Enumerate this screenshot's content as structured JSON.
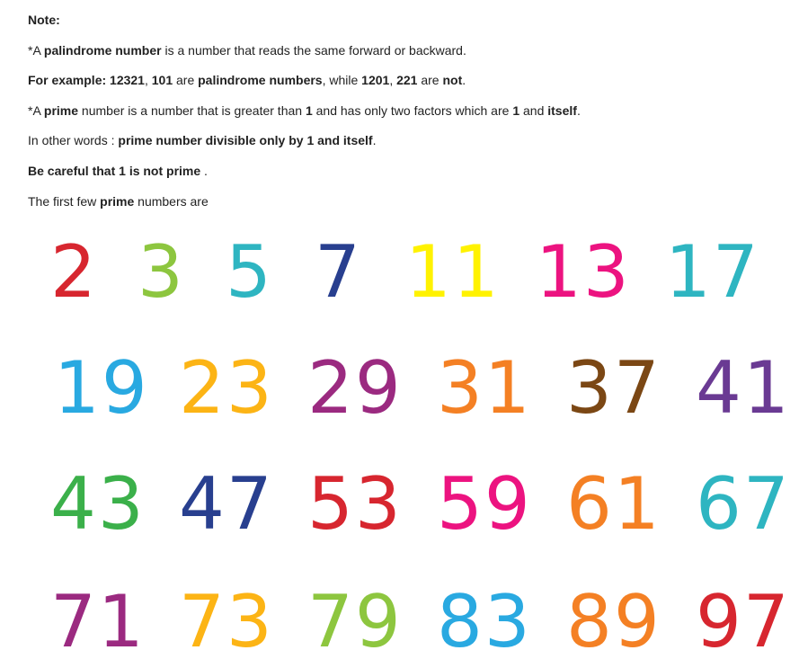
{
  "note": {
    "heading": "Note:",
    "line1": {
      "prefix": "*A ",
      "term": "palindrome number",
      "rest": " is a number that reads the same forward or backward."
    },
    "line2": {
      "label": "For example: ",
      "ex1": "12321",
      "sep1": ", ",
      "ex2": "101",
      "mid1": " are ",
      "term": "palindrome numbers",
      "mid2": ", while ",
      "ex3": "1201",
      "sep2": ", ",
      "ex4": "221",
      "mid3": " are ",
      "neg": "not",
      "end": "."
    },
    "line3": {
      "prefix": "*A ",
      "term": "prime",
      "mid1": " number is a number that is greater than ",
      "one1": "1",
      "mid2": " and has only two factors which are ",
      "one2": "1",
      "mid3": " and ",
      "itself": "itself",
      "end": "."
    },
    "line4": {
      "prefix": "In other words : ",
      "bold": "prime number divisible only by 1 and itself",
      "end": "."
    },
    "line5": {
      "bold": "Be careful that 1 is not prime",
      "end": " ."
    },
    "line6": {
      "prefix": "The first few ",
      "term": "prime",
      "rest": " numbers are"
    }
  },
  "primes": [
    {
      "value": "2",
      "color": "#d7262f"
    },
    {
      "value": "3",
      "color": "#8dc63f"
    },
    {
      "value": "5",
      "color": "#2eb5c1"
    },
    {
      "value": "7",
      "color": "#283f8f"
    },
    {
      "value": "11",
      "color": "#fff200"
    },
    {
      "value": "13",
      "color": "#ec1380"
    },
    {
      "value": "17",
      "color": "#2eb5c1"
    },
    {
      "value": "19",
      "color": "#29a9e1"
    },
    {
      "value": "23",
      "color": "#fcb415"
    },
    {
      "value": "29",
      "color": "#9b2a80"
    },
    {
      "value": "31",
      "color": "#f48024"
    },
    {
      "value": "37",
      "color": "#7b4714"
    },
    {
      "value": "41",
      "color": "#6a3a93"
    },
    {
      "value": "43",
      "color": "#3bb04a"
    },
    {
      "value": "47",
      "color": "#283f8f"
    },
    {
      "value": "53",
      "color": "#d7262f"
    },
    {
      "value": "59",
      "color": "#ec1380"
    },
    {
      "value": "61",
      "color": "#f48024"
    },
    {
      "value": "67",
      "color": "#2eb5c1"
    },
    {
      "value": "71",
      "color": "#9b2a80"
    },
    {
      "value": "73",
      "color": "#fcb415"
    },
    {
      "value": "79",
      "color": "#8dc63f"
    },
    {
      "value": "83",
      "color": "#29a9e1"
    },
    {
      "value": "89",
      "color": "#f48024"
    },
    {
      "value": "97",
      "color": "#d7262f"
    }
  ]
}
